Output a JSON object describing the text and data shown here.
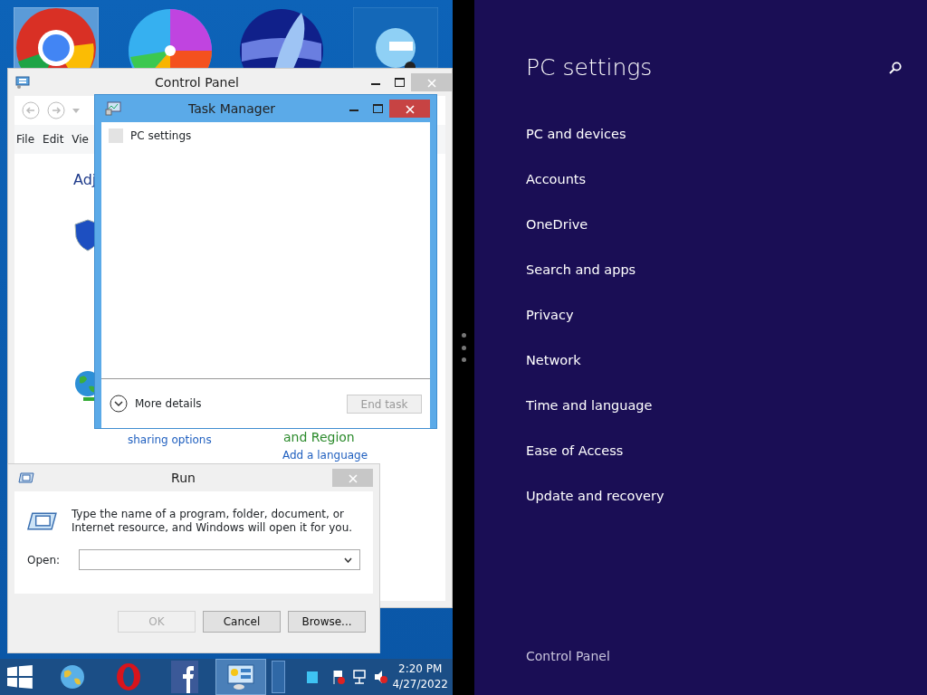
{
  "control_panel": {
    "title": "Control Panel",
    "menu": [
      "File",
      "Edit",
      "Vie"
    ],
    "heading": "Adj",
    "group_title": "and Region",
    "links": [
      "sharing options",
      "Add a language"
    ]
  },
  "task_manager": {
    "title": "Task Manager",
    "apps": [
      {
        "name": "PC settings"
      }
    ],
    "more_details": "More details",
    "end_task": {
      "label": "End task",
      "disabled": true
    }
  },
  "run": {
    "title": "Run",
    "message": "Type the name of a program, folder, document, or Internet resource, and Windows will open it for you.",
    "open_label": "Open:",
    "buttons": [
      {
        "label": "OK",
        "disabled": true
      },
      {
        "label": "Cancel",
        "disabled": false
      },
      {
        "label": "Browse...",
        "disabled": false
      }
    ]
  },
  "taskbar": {
    "items": [
      {
        "kind": "globe",
        "selected": false
      },
      {
        "kind": "opera",
        "selected": false
      },
      {
        "kind": "facebook",
        "selected": false
      },
      {
        "kind": "control",
        "selected": true
      }
    ],
    "time": "2:20 PM",
    "date": "4/27/2022"
  },
  "pc_settings": {
    "title": "PC settings",
    "items": [
      "PC and devices",
      "Accounts",
      "OneDrive",
      "Search and apps",
      "Privacy",
      "Network",
      "Time and language",
      "Ease of Access",
      "Update and recovery"
    ],
    "footer": "Control Panel"
  }
}
